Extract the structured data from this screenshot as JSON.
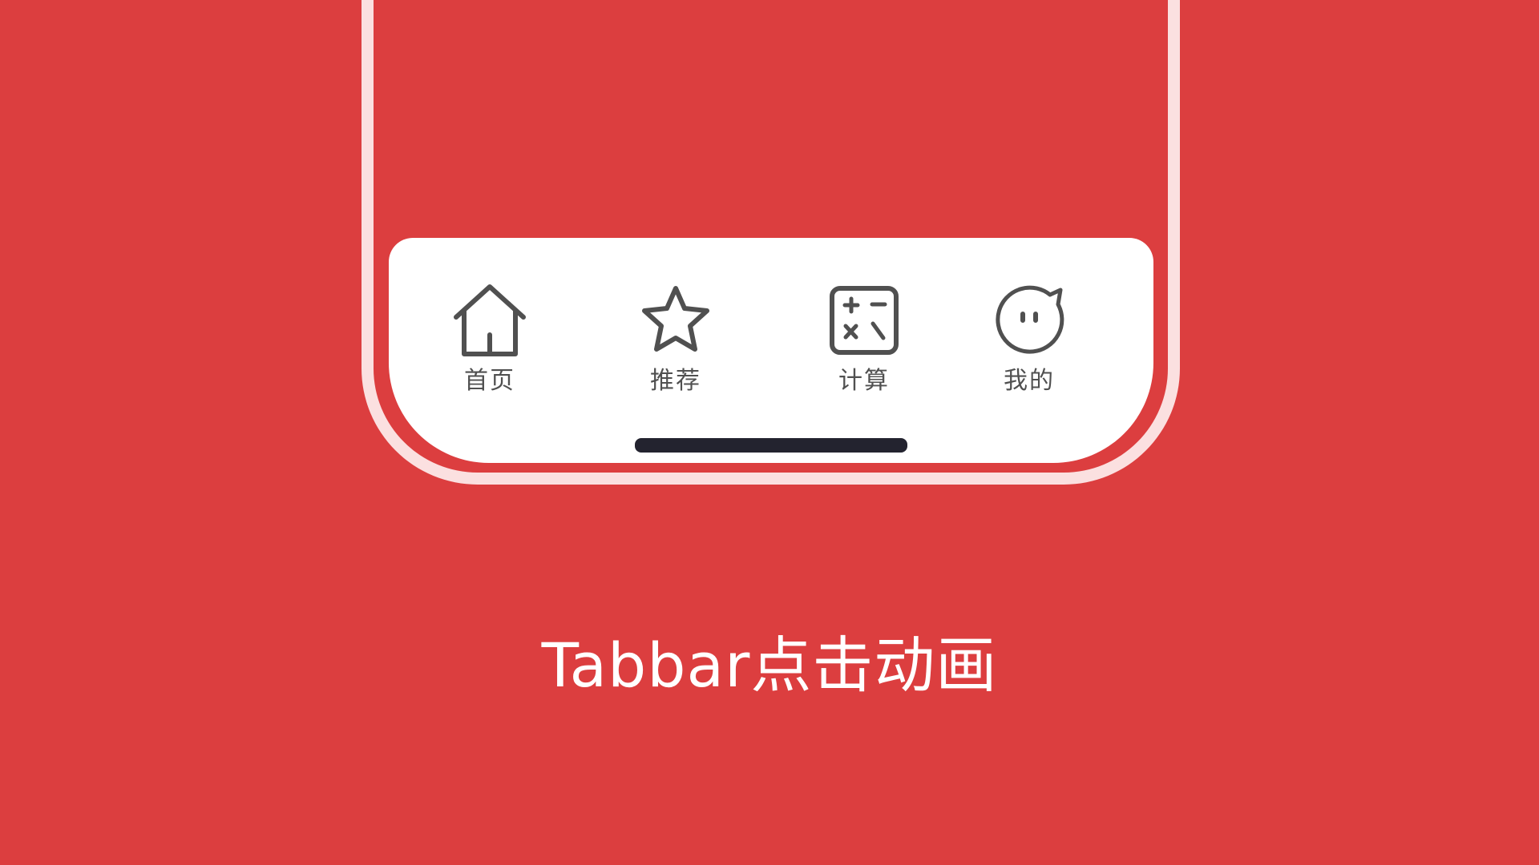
{
  "tabbar": {
    "tabs": [
      {
        "label": "首页",
        "icon": "home-icon"
      },
      {
        "label": "推荐",
        "icon": "star-icon"
      },
      {
        "label": "计算",
        "icon": "calculator-icon"
      },
      {
        "label": "我的",
        "icon": "face-chat-icon"
      }
    ]
  },
  "caption": "Tabbar点击动画",
  "colors": {
    "background": "#dc3e3f",
    "frame": "#fbe0e0",
    "tabbar": "#ffffff",
    "icon_stroke": "#505050",
    "home_indicator": "#23232f",
    "caption_text": "#ffffff"
  }
}
